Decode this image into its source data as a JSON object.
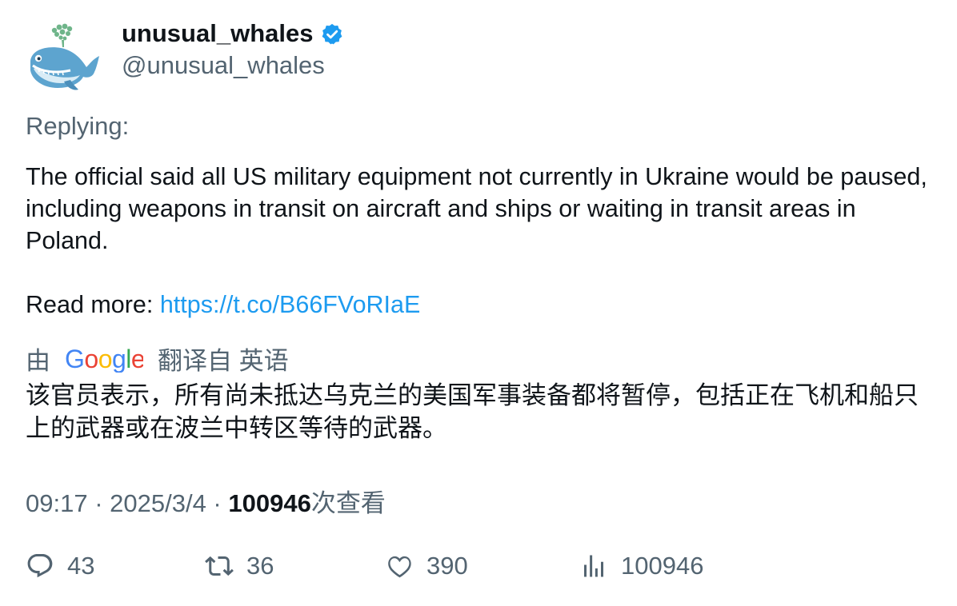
{
  "author": {
    "display_name": "unusual_whales",
    "handle": "@unusual_whales",
    "verified": true
  },
  "replying_label": "Replying:",
  "tweet": {
    "text": "The official said all US military equipment not currently in Ukraine would be paused, including weapons in transit on aircraft and ships or waiting in transit areas in Poland.",
    "read_more_label": "Read more: ",
    "link": "https://t.co/B66FVoRIaE"
  },
  "translation": {
    "by_label": "由",
    "provider": "Google",
    "from_label": "翻译自 英语",
    "text": "该官员表示，所有尚未抵达乌克兰的美国军事装备都将暂停，包括正在飞机和船只上的武器或在波兰中转区等待的武器。"
  },
  "meta": {
    "time": "09:17",
    "separator": " · ",
    "date": "2025/3/4",
    "views": "100946",
    "views_label": "次查看"
  },
  "actions": {
    "replies": "43",
    "retweets": "36",
    "likes": "390",
    "views": "100946"
  },
  "colors": {
    "accent": "#1d9bf0",
    "muted": "#536471",
    "text": "#0f1419"
  }
}
